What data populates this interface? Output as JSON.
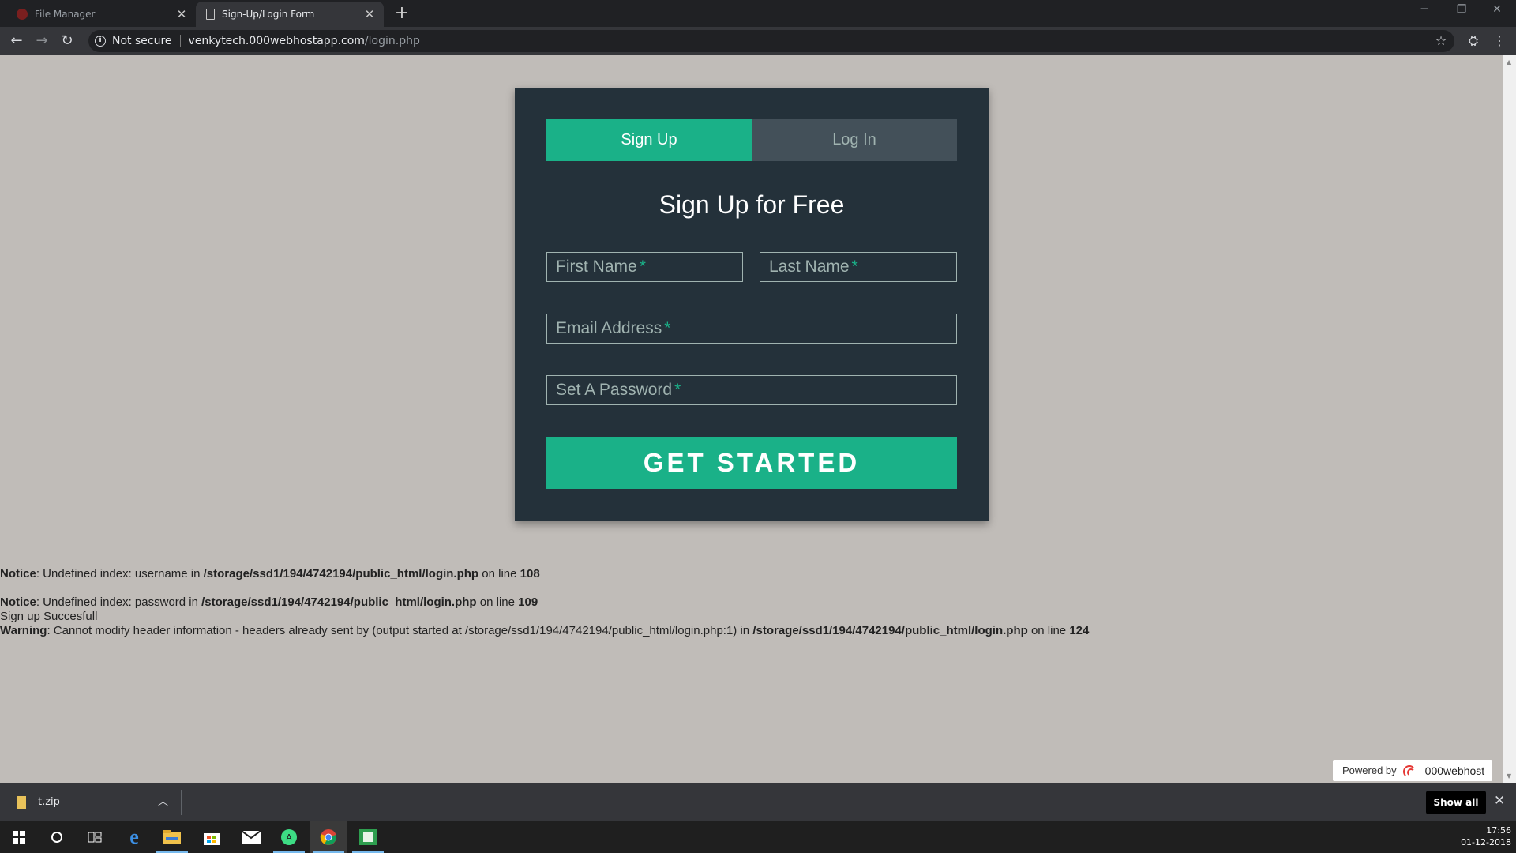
{
  "browser": {
    "tabs": [
      {
        "title": "File Manager",
        "active": false,
        "favicon": "file-manager-icon"
      },
      {
        "title": "Sign-Up/Login Form",
        "active": true,
        "favicon": "document-icon"
      }
    ],
    "new_tab": "+",
    "security_label": "Not secure",
    "url_domain": "venkytech.000webhostapp.com",
    "url_path": "/login.php"
  },
  "form": {
    "tabs": {
      "signup": "Sign Up",
      "login": "Log In"
    },
    "heading": "Sign Up for Free",
    "fields": {
      "first_name": "First Name",
      "last_name": "Last Name",
      "email": "Email Address",
      "password": "Set A Password"
    },
    "required_marker": "*",
    "submit": "GET STARTED",
    "colors": {
      "accent": "#1ab188",
      "card": "#24313a",
      "inactive_tab": "#435059"
    }
  },
  "php_output": {
    "notice1": {
      "label": "Notice",
      "text": ": Undefined index: username in ",
      "path": "/storage/ssd1/194/4742194/public_html/login.php",
      "on_line": " on line ",
      "line": "108"
    },
    "notice2": {
      "label": "Notice",
      "text": ": Undefined index: password in ",
      "path": "/storage/ssd1/194/4742194/public_html/login.php",
      "on_line": " on line ",
      "line": "109"
    },
    "message": "Sign up Succesfull",
    "warning": {
      "label": "Warning",
      "text": ": Cannot modify header information - headers already sent by (output started at /storage/ssd1/194/4742194/public_html/login.php:1) in ",
      "path": "/storage/ssd1/194/4742194/public_html/login.php",
      "on_line": " on line ",
      "line": "124"
    }
  },
  "powered_by": {
    "label": "Powered by",
    "brand": "000webhost"
  },
  "downloads": {
    "file": "t.zip",
    "show_all": "Show all"
  },
  "taskbar": {
    "time": "17:56",
    "date": "01-12-2018",
    "icons": [
      "windows-start-icon",
      "cortana-search-icon",
      "task-view-icon",
      "edge-icon",
      "file-explorer-icon",
      "store-icon",
      "mail-icon",
      "android-studio-icon",
      "chrome-icon",
      "app-icon"
    ]
  }
}
